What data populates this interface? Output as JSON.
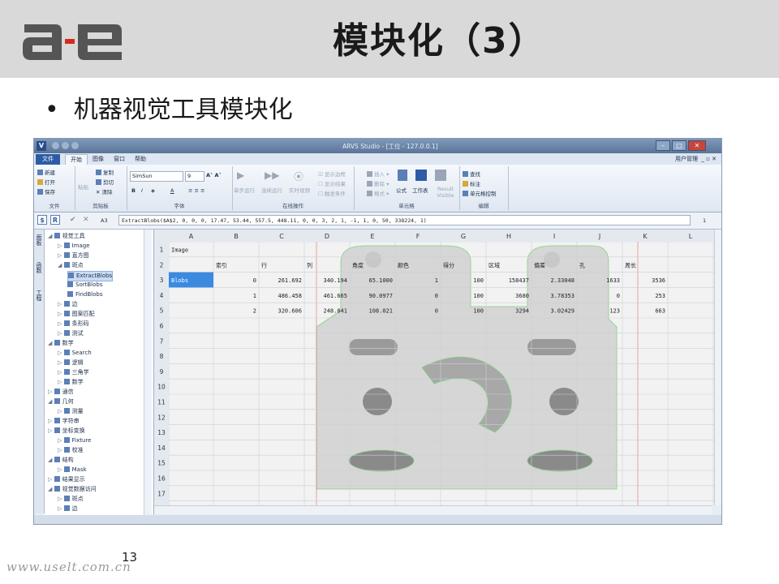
{
  "slide": {
    "title": "模块化（3）",
    "bullet": "机器视觉工具模块化",
    "page_number": "13",
    "watermark": "www.uselt.com.cn"
  },
  "logo": {
    "text": "a-e"
  },
  "app": {
    "window_title": "ARVS Studio - [工位 - 127.0.0.1]",
    "tabs": [
      "文件",
      "开始",
      "图像",
      "窗口",
      "帮助"
    ],
    "right_menu": "用户管理",
    "ribbon": {
      "clipboard": {
        "name": "剪贴板",
        "paste": "粘贴",
        "copy": "复制",
        "cut": "剪切",
        "clear": "清除"
      },
      "file": {
        "name": "文件",
        "new": "新建",
        "open": "打开",
        "save": "保存"
      },
      "font": {
        "name": "字体",
        "font_name": "SimSun",
        "font_size": "9"
      },
      "online": {
        "name": "在线操作",
        "run_once": "单步运行",
        "run_continuous": "连续运行",
        "stop": "实时视频",
        "calc": "计算结果",
        "check1": "显示边框",
        "check2": "显示结果",
        "check3": "触发条件"
      },
      "cells": {
        "name": "单元格",
        "insert": "插入",
        "delete": "删除",
        "format": "格式",
        "formula": "公式",
        "worksheet": "工作表",
        "result_visible": "Result Visible"
      },
      "edit": {
        "name": "编辑",
        "find": "查找",
        "mark": "标注",
        "range": "单元格控制"
      }
    },
    "formula_bar": {
      "cell_ref": "A3",
      "formula": "ExtractBlobs($A$2, 0, 0, 0, 17.47, 53.44, 557.5, 448.11, 0, 0, 3, 2, 1, -1, 1, 0, 50, 338224, 1)",
      "right_value": "1"
    },
    "vertical_tabs": [
      "面板",
      "函数",
      "工程"
    ],
    "tree": [
      {
        "label": "视觉工具",
        "level": 0
      },
      {
        "label": "Image",
        "level": 1
      },
      {
        "label": "直方图",
        "level": 1
      },
      {
        "label": "斑点",
        "level": 1
      },
      {
        "label": "ExtractBlobs",
        "level": 2,
        "selected": true
      },
      {
        "label": "SortBlobs",
        "level": 2
      },
      {
        "label": "FindBlobs",
        "level": 2
      },
      {
        "label": "边",
        "level": 1
      },
      {
        "label": "图案匹配",
        "level": 1
      },
      {
        "label": "条形码",
        "level": 1
      },
      {
        "label": "测试",
        "level": 1
      },
      {
        "label": "数学",
        "level": 0
      },
      {
        "label": "Search",
        "level": 1
      },
      {
        "label": "逻辑",
        "level": 1
      },
      {
        "label": "三角学",
        "level": 1
      },
      {
        "label": "数学",
        "level": 1
      },
      {
        "label": "通信",
        "level": 0
      },
      {
        "label": "几何",
        "level": 0
      },
      {
        "label": "测量",
        "level": 1
      },
      {
        "label": "字符串",
        "level": 0
      },
      {
        "label": "坐标变换",
        "level": 0
      },
      {
        "label": "Fixture",
        "level": 1
      },
      {
        "label": "校准",
        "level": 1
      },
      {
        "label": "结构",
        "level": 0
      },
      {
        "label": "Mask",
        "level": 1
      },
      {
        "label": "结果显示",
        "level": 0
      },
      {
        "label": "视觉数据访问",
        "level": 0
      },
      {
        "label": "斑点",
        "level": 1
      },
      {
        "label": "边",
        "level": 1
      }
    ],
    "grid": {
      "columns": [
        "A",
        "B",
        "C",
        "D",
        "E",
        "F",
        "G",
        "H",
        "I",
        "J",
        "K",
        "L"
      ],
      "rows": [
        "1",
        "2",
        "3",
        "4",
        "5",
        "6",
        "7",
        "8",
        "9",
        "10",
        "11",
        "12",
        "13",
        "14",
        "15",
        "16",
        "17"
      ],
      "cells": {
        "A1": "Image",
        "B2": "索引",
        "C2": "行",
        "D2": "列",
        "E2": "角度",
        "F2": "颜色",
        "G2": "得分",
        "H2": "区域",
        "I2": "偏差",
        "J2": "孔",
        "K2": "周长",
        "A3": "Blobs",
        "B3": "0",
        "C3": "261.692",
        "D3": "340.194",
        "E3": "65.1000",
        "F3": "1",
        "G3": "100",
        "H3": "158437",
        "I3": "2.33048",
        "J3": "1633",
        "K3": "3536",
        "B4": "1",
        "C4": "486.458",
        "D4": "461.665",
        "E4": "90.0977",
        "F4": "0",
        "G4": "100",
        "H4": "3680",
        "I4": "3.78353",
        "J4": "0",
        "K4": "253",
        "B5": "2",
        "C5": "320.606",
        "D5": "248.841",
        "E5": "108.021",
        "F5": "0",
        "G5": "100",
        "H5": "3294",
        "I5": "3.02429",
        "J5": "123",
        "K5": "663"
      }
    }
  }
}
